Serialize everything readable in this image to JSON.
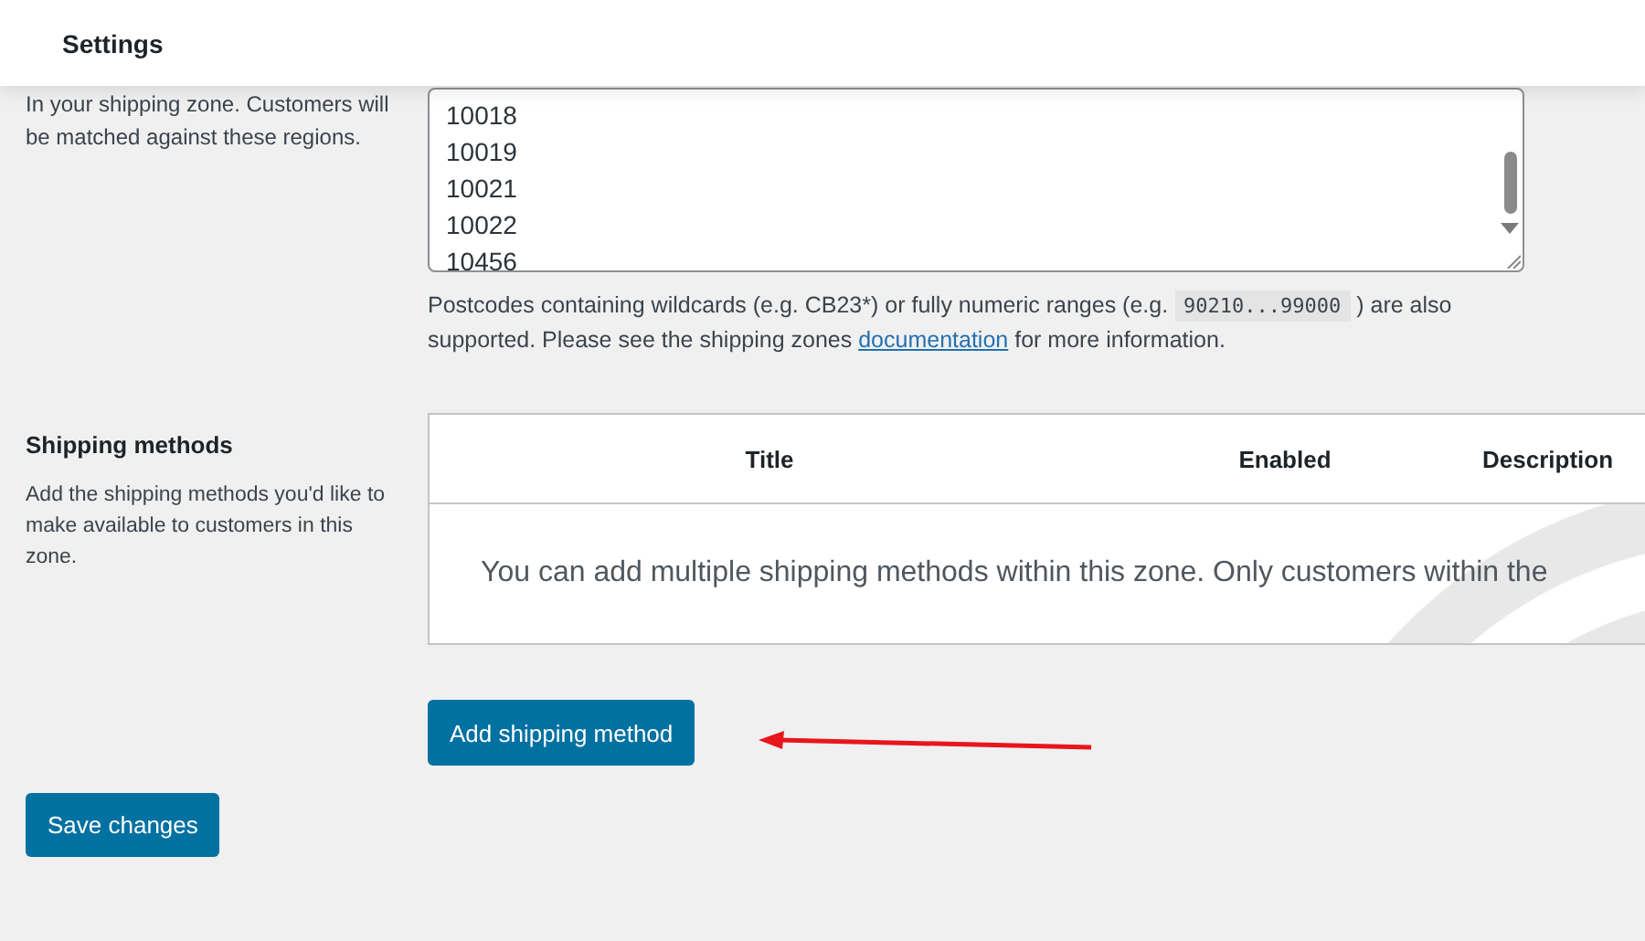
{
  "header": {
    "title": "Settings"
  },
  "zone_regions": {
    "description": "In your shipping zone. Customers will be matched against these regions.",
    "postcodes": [
      "10018",
      "10019",
      "10021",
      "10022",
      "10456"
    ],
    "help": {
      "before": "Postcodes containing wildcards (e.g. CB23*) or fully numeric ranges (e.g.",
      "code": "90210...99000",
      "after": ") are also supported. Please see the shipping zones",
      "link": "documentation",
      "end": "for more information."
    }
  },
  "shipping_methods": {
    "heading": "Shipping methods",
    "description": "Add the shipping methods you'd like to make available to customers in this zone.",
    "table": {
      "columns": [
        "Title",
        "Enabled",
        "Description"
      ],
      "empty_message": "You can add multiple shipping methods within this zone. Only customers within the"
    },
    "add_button": "Add shipping method"
  },
  "save_button": "Save changes"
}
